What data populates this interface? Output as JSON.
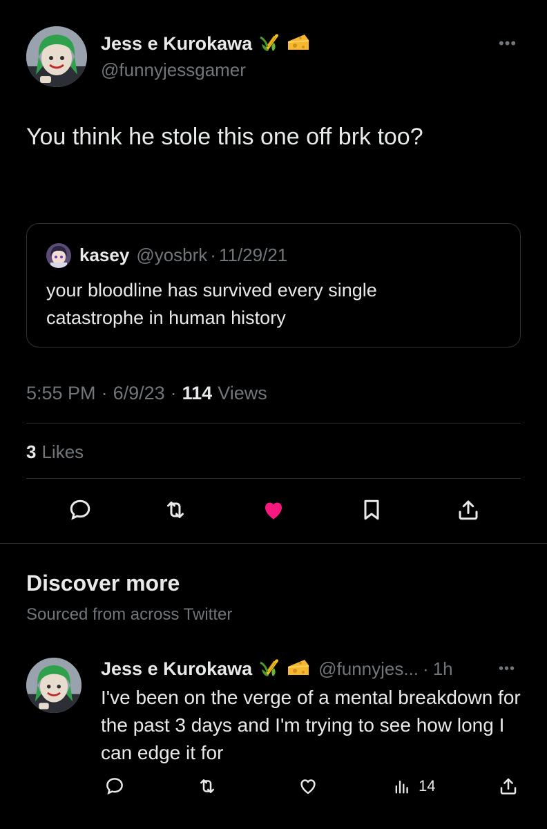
{
  "tweet": {
    "author_name": "Jess e Kurokawa",
    "author_emojis": [
      "corn",
      "cheese"
    ],
    "author_handle": "@funnyjessgamer",
    "more_label": "•••",
    "text": "You think he stole this one off brk too?",
    "quote": {
      "name": "kasey",
      "handle": "@yosbrk",
      "separator": "·",
      "date": "11/29/21",
      "text": "your bloodline has survived every single catastrophe in human history"
    },
    "time": "5:55 PM",
    "date": "6/9/23",
    "separator": "·",
    "views_count": "114",
    "views_label": "Views",
    "likes_count": "3",
    "likes_label": "Likes",
    "actions": [
      "reply-icon",
      "retweet-icon",
      "like-icon-filled",
      "bookmark-icon",
      "share-icon"
    ],
    "liked_color": "#f91880"
  },
  "discover": {
    "title": "Discover more",
    "subtitle": "Sourced from across Twitter",
    "items": [
      {
        "author_name": "Jess e Kurokawa",
        "author_emojis": [
          "corn",
          "cheese"
        ],
        "author_handle": "@funnyjes...",
        "separator": "·",
        "time": "1h",
        "more_label": "•••",
        "text": "I've been on the verge of a mental breakdown for the past 3 days and I'm trying to see how long I can edge it for",
        "views_count": "14",
        "actions": [
          "reply-icon",
          "retweet-icon",
          "like-icon",
          "views-icon",
          "share-icon"
        ]
      }
    ]
  },
  "colors": {
    "background": "#000000",
    "text_primary": "#e7e9ea",
    "text_secondary": "#71767b",
    "border": "#2f3336",
    "like": "#f91880"
  }
}
